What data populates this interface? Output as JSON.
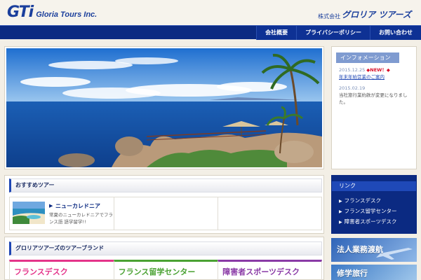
{
  "header": {
    "logo_mark": "GTi",
    "logo_text": "Gloria Tours Inc.",
    "corp_prefix": "株式会社",
    "corp_name": "グロリア ツアーズ"
  },
  "nav": {
    "tabs": [
      "会社概要",
      "プライバシーポリシー",
      "お問い合わせ"
    ]
  },
  "info": {
    "title": "インフォメーション",
    "items": [
      {
        "date": "2015.12.25",
        "badge": "◆NEW！◆",
        "text": "年末年始営業のご案内"
      },
      {
        "date": "2015.02.19",
        "text": "当社旅行業約款が変更になりました。"
      }
    ]
  },
  "recommend": {
    "title": "おすすめツアー",
    "tours": [
      {
        "name": "ニューカレドニア",
        "desc": "常夏のニューカレドニアでフランス語 語学留学!!"
      }
    ]
  },
  "brands": {
    "title": "グロリアツアーズのツアーブランド",
    "items": [
      {
        "name": "フランスデスク",
        "color": "#e4348a"
      },
      {
        "name": "フランス留学センター",
        "color": "#4aa233"
      },
      {
        "name": "障害者スポーツデスク",
        "color": "#8a3aa6"
      }
    ]
  },
  "links": {
    "title": "リンク",
    "items": [
      "フランスデスク",
      "フランス留学センター",
      "障害者スポーツデスク"
    ]
  },
  "banners": [
    "法人業務渡航",
    "修学旅行"
  ],
  "colors": {
    "navy": "#0b2a82",
    "accent": "#1e46b4",
    "new_badge": "#d8102a"
  }
}
